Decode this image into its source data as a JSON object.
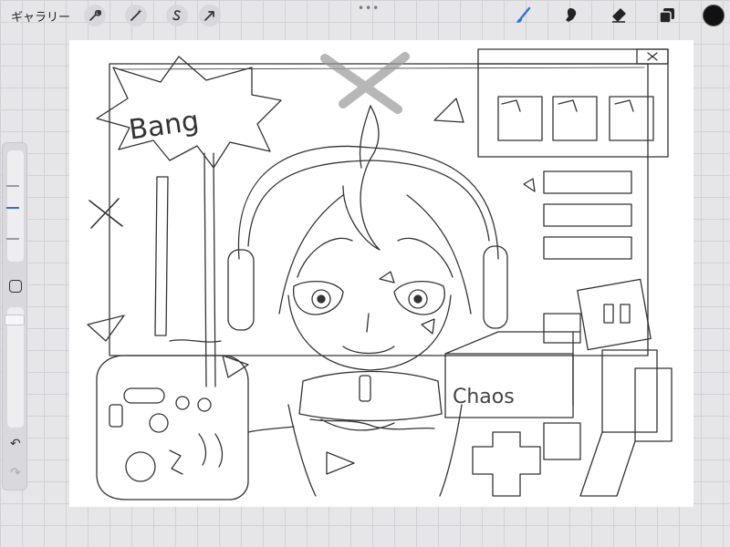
{
  "toolbar": {
    "gallery_label": "ギャラリー",
    "left_tools": [
      {
        "name": "actions",
        "icon": "wrench-icon"
      },
      {
        "name": "adjustments",
        "icon": "magic-wand-icon"
      },
      {
        "name": "selection",
        "icon": "selection-s-icon"
      },
      {
        "name": "transform",
        "icon": "arrow-cursor-icon"
      }
    ],
    "more_dots": "•••",
    "right_tools": [
      {
        "name": "brush",
        "icon": "brush-icon",
        "active": true
      },
      {
        "name": "smudge",
        "icon": "smudge-icon"
      },
      {
        "name": "eraser",
        "icon": "eraser-icon"
      },
      {
        "name": "layers",
        "icon": "layers-icon"
      }
    ],
    "current_color": "#111111",
    "accent_color": "#2f6fe0"
  },
  "sidebar": {
    "brush_size_icon": "brush-size-slider",
    "modify_icon": "square-modify-icon",
    "opacity_icon": "opacity-slider",
    "undo": "↶",
    "redo": "↷"
  },
  "canvas": {
    "text_bang": "Bang",
    "text_chaos": "Chaos"
  }
}
